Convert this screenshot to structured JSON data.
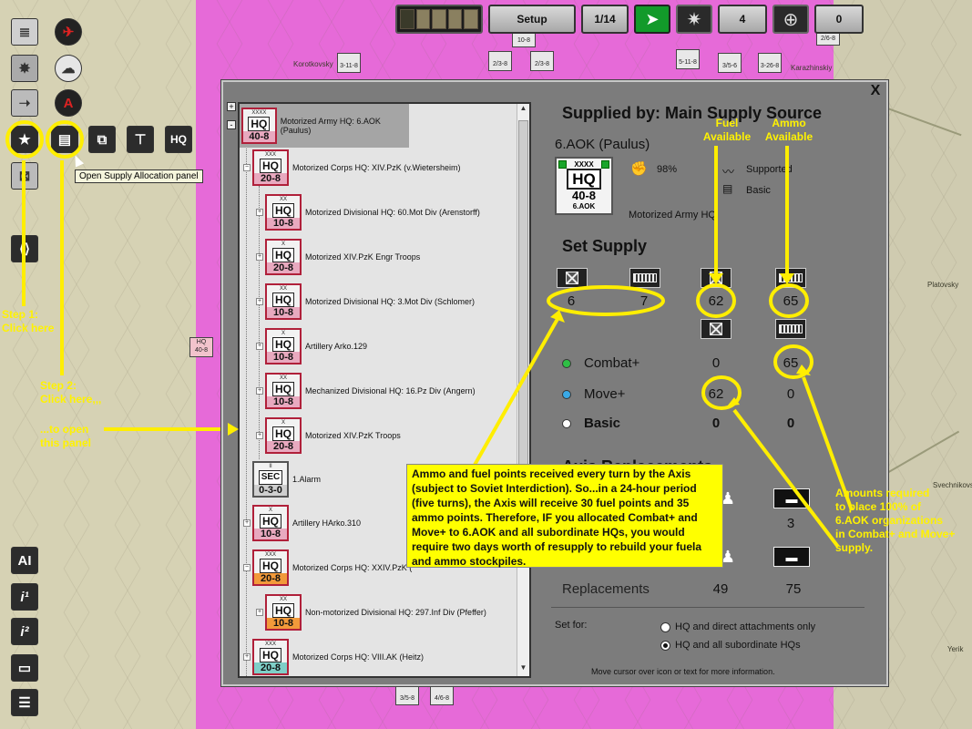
{
  "colors": {
    "annotation": "#ffee00",
    "map_pink": "#e66ad8",
    "panel_bg": "#7c7c7c",
    "hq_border": "#b0203a",
    "go_button": "#129a2a"
  },
  "top_bar": {
    "phase_label": "Setup",
    "turn_label": "1/14",
    "go_icon": "arrow-right-icon",
    "recon_count": "4",
    "target_count": "0"
  },
  "map": {
    "towns": [
      "Korotkovsky",
      "Karazhinskiy",
      "Platovsky",
      "Svechnikovsky",
      "Yerik"
    ],
    "units_top": [
      "10-8",
      "3-11-8",
      "2/3-8",
      "2/3-8",
      "5-11-8",
      "3/5-6",
      "3-26-8",
      "2/6-8"
    ],
    "units_bottom": [
      "3/5-8",
      "4/6-8"
    ]
  },
  "left_toolbar": {
    "tooltip": "Open Supply Allocation panel",
    "hq_button": "HQ",
    "ai_button": "AI",
    "info1_button": "i¹",
    "info2_button": "i²"
  },
  "annotations": {
    "step1": [
      "Step 1:",
      "Click here"
    ],
    "step2": [
      "Step 2:",
      "Click here,,,"
    ],
    "open_panel": [
      "...to open",
      "this panel"
    ],
    "fuel_available": [
      "Fuel",
      "Available"
    ],
    "ammo_available": [
      "Ammo",
      "Available"
    ],
    "amounts_required": [
      "Amounts required",
      "to place 100% of",
      "6.AOK organizations",
      "in Combat+ and Move+",
      "supply."
    ],
    "note": "Ammo and fuel points received every turn by the Axis (subject to Soviet Interdiction).  So...in a 24-hour period (five turns), the Axis will receive 30 fuel points and 35 ammo points. Therefore, IF you allocated Combat+ and Move+ to 6.AOK and all subordinate HQs, you would require two days worth of resupply to rebuild your fuela and ammo stockpiles."
  },
  "panel": {
    "close": "X",
    "tree": [
      {
        "size": "XXXX",
        "type": "HQ",
        "str": "40-8",
        "label": "Motorized Army HQ: 6.AOK (Paulus)",
        "style": "pink"
      },
      {
        "size": "XXX",
        "type": "HQ",
        "str": "20-8",
        "label": "Motorized Corps HQ: XIV.PzK (v.Wietersheim)",
        "style": "pink"
      },
      {
        "size": "XX",
        "type": "HQ",
        "str": "10-8",
        "label": "Motorized Divisional HQ: 60.Mot Div (Arenstorff)",
        "style": "pink"
      },
      {
        "size": "X",
        "type": "HQ",
        "str": "20-8",
        "label": "Motorized XIV.PzK Engr Troops",
        "style": "pink"
      },
      {
        "size": "XX",
        "type": "HQ",
        "str": "10-8",
        "label": "Motorized Divisional HQ: 3.Mot Div (Schlomer)",
        "style": "pink"
      },
      {
        "size": "X",
        "type": "HQ",
        "str": "10-8",
        "label": "Artillery Arko.129",
        "style": "pink"
      },
      {
        "size": "XX",
        "type": "HQ",
        "str": "10-8",
        "label": "Mechanized Divisional HQ: 16.Pz Div (Angern)",
        "style": "pink"
      },
      {
        "size": "X",
        "type": "HQ",
        "str": "20-8",
        "label": "Motorized XIV.PzK Troops",
        "style": "pink"
      },
      {
        "size": "II",
        "type": "SEC",
        "str": "0-3-0",
        "label": "1.Alarm",
        "style": "grey"
      },
      {
        "size": "X",
        "type": "HQ",
        "str": "10-8",
        "label": "Artillery HArko.310",
        "style": "pink"
      },
      {
        "size": "XXX",
        "type": "HQ",
        "str": "20-8",
        "label": "Motorized Corps HQ: XXIV.PzK (",
        "style": "orange"
      },
      {
        "size": "XX",
        "type": "HQ",
        "str": "10-8",
        "label": "Non-motorized Divisional HQ: 297.Inf Div (Pfeffer)",
        "style": "orange"
      },
      {
        "size": "XXX",
        "type": "HQ",
        "str": "20-8",
        "label": "Motorized Corps HQ: VIII.AK (Heitz)",
        "style": "teal"
      }
    ],
    "header": "Supplied by: Main Supply Source",
    "unit_name": "6.AOK (Paulus)",
    "unit_counter": {
      "size": "XXXX",
      "type": "HQ",
      "str": "40-8",
      "name": "6.AOK"
    },
    "unit_pct": "98%",
    "unit_status1": "Supported",
    "unit_status2": "Basic",
    "unit_type": "Motorized Army HQ",
    "set_supply_title": "Set Supply",
    "supply_values": {
      "col1": "6",
      "col2": "7",
      "fuel": "62",
      "ammo": "65"
    },
    "rows": [
      {
        "label": "Combat+",
        "fuel": "0",
        "ammo": "65",
        "dot": "#2fbf45"
      },
      {
        "label": "Move+",
        "fuel": "62",
        "ammo": "0",
        "dot": "#3aa9e6"
      },
      {
        "label": "Basic",
        "fuel": "0",
        "ammo": "0",
        "dot": "#ffffff"
      }
    ],
    "replacements_title_visible": "Axis Replacements",
    "repl_row1_right": "3",
    "replacements_label": "Replacements",
    "replacements_values": [
      "49",
      "75"
    ],
    "set_for_label": "Set for:",
    "radio_options": [
      "HQ and direct attachments only",
      "HQ and all subordinate HQs"
    ],
    "footer": "Move cursor over icon or text for more information."
  }
}
